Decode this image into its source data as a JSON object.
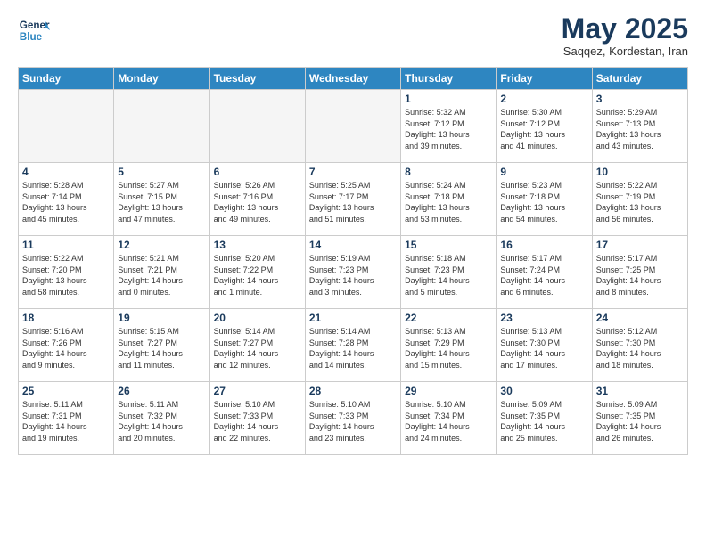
{
  "header": {
    "logo_line1": "General",
    "logo_line2": "Blue",
    "month": "May 2025",
    "location": "Saqqez, Kordestan, Iran"
  },
  "weekdays": [
    "Sunday",
    "Monday",
    "Tuesday",
    "Wednesday",
    "Thursday",
    "Friday",
    "Saturday"
  ],
  "weeks": [
    [
      {
        "day": "",
        "info": ""
      },
      {
        "day": "",
        "info": ""
      },
      {
        "day": "",
        "info": ""
      },
      {
        "day": "",
        "info": ""
      },
      {
        "day": "1",
        "info": "Sunrise: 5:32 AM\nSunset: 7:12 PM\nDaylight: 13 hours\nand 39 minutes."
      },
      {
        "day": "2",
        "info": "Sunrise: 5:30 AM\nSunset: 7:12 PM\nDaylight: 13 hours\nand 41 minutes."
      },
      {
        "day": "3",
        "info": "Sunrise: 5:29 AM\nSunset: 7:13 PM\nDaylight: 13 hours\nand 43 minutes."
      }
    ],
    [
      {
        "day": "4",
        "info": "Sunrise: 5:28 AM\nSunset: 7:14 PM\nDaylight: 13 hours\nand 45 minutes."
      },
      {
        "day": "5",
        "info": "Sunrise: 5:27 AM\nSunset: 7:15 PM\nDaylight: 13 hours\nand 47 minutes."
      },
      {
        "day": "6",
        "info": "Sunrise: 5:26 AM\nSunset: 7:16 PM\nDaylight: 13 hours\nand 49 minutes."
      },
      {
        "day": "7",
        "info": "Sunrise: 5:25 AM\nSunset: 7:17 PM\nDaylight: 13 hours\nand 51 minutes."
      },
      {
        "day": "8",
        "info": "Sunrise: 5:24 AM\nSunset: 7:18 PM\nDaylight: 13 hours\nand 53 minutes."
      },
      {
        "day": "9",
        "info": "Sunrise: 5:23 AM\nSunset: 7:18 PM\nDaylight: 13 hours\nand 54 minutes."
      },
      {
        "day": "10",
        "info": "Sunrise: 5:22 AM\nSunset: 7:19 PM\nDaylight: 13 hours\nand 56 minutes."
      }
    ],
    [
      {
        "day": "11",
        "info": "Sunrise: 5:22 AM\nSunset: 7:20 PM\nDaylight: 13 hours\nand 58 minutes."
      },
      {
        "day": "12",
        "info": "Sunrise: 5:21 AM\nSunset: 7:21 PM\nDaylight: 14 hours\nand 0 minutes."
      },
      {
        "day": "13",
        "info": "Sunrise: 5:20 AM\nSunset: 7:22 PM\nDaylight: 14 hours\nand 1 minute."
      },
      {
        "day": "14",
        "info": "Sunrise: 5:19 AM\nSunset: 7:23 PM\nDaylight: 14 hours\nand 3 minutes."
      },
      {
        "day": "15",
        "info": "Sunrise: 5:18 AM\nSunset: 7:23 PM\nDaylight: 14 hours\nand 5 minutes."
      },
      {
        "day": "16",
        "info": "Sunrise: 5:17 AM\nSunset: 7:24 PM\nDaylight: 14 hours\nand 6 minutes."
      },
      {
        "day": "17",
        "info": "Sunrise: 5:17 AM\nSunset: 7:25 PM\nDaylight: 14 hours\nand 8 minutes."
      }
    ],
    [
      {
        "day": "18",
        "info": "Sunrise: 5:16 AM\nSunset: 7:26 PM\nDaylight: 14 hours\nand 9 minutes."
      },
      {
        "day": "19",
        "info": "Sunrise: 5:15 AM\nSunset: 7:27 PM\nDaylight: 14 hours\nand 11 minutes."
      },
      {
        "day": "20",
        "info": "Sunrise: 5:14 AM\nSunset: 7:27 PM\nDaylight: 14 hours\nand 12 minutes."
      },
      {
        "day": "21",
        "info": "Sunrise: 5:14 AM\nSunset: 7:28 PM\nDaylight: 14 hours\nand 14 minutes."
      },
      {
        "day": "22",
        "info": "Sunrise: 5:13 AM\nSunset: 7:29 PM\nDaylight: 14 hours\nand 15 minutes."
      },
      {
        "day": "23",
        "info": "Sunrise: 5:13 AM\nSunset: 7:30 PM\nDaylight: 14 hours\nand 17 minutes."
      },
      {
        "day": "24",
        "info": "Sunrise: 5:12 AM\nSunset: 7:30 PM\nDaylight: 14 hours\nand 18 minutes."
      }
    ],
    [
      {
        "day": "25",
        "info": "Sunrise: 5:11 AM\nSunset: 7:31 PM\nDaylight: 14 hours\nand 19 minutes."
      },
      {
        "day": "26",
        "info": "Sunrise: 5:11 AM\nSunset: 7:32 PM\nDaylight: 14 hours\nand 20 minutes."
      },
      {
        "day": "27",
        "info": "Sunrise: 5:10 AM\nSunset: 7:33 PM\nDaylight: 14 hours\nand 22 minutes."
      },
      {
        "day": "28",
        "info": "Sunrise: 5:10 AM\nSunset: 7:33 PM\nDaylight: 14 hours\nand 23 minutes."
      },
      {
        "day": "29",
        "info": "Sunrise: 5:10 AM\nSunset: 7:34 PM\nDaylight: 14 hours\nand 24 minutes."
      },
      {
        "day": "30",
        "info": "Sunrise: 5:09 AM\nSunset: 7:35 PM\nDaylight: 14 hours\nand 25 minutes."
      },
      {
        "day": "31",
        "info": "Sunrise: 5:09 AM\nSunset: 7:35 PM\nDaylight: 14 hours\nand 26 minutes."
      }
    ]
  ]
}
